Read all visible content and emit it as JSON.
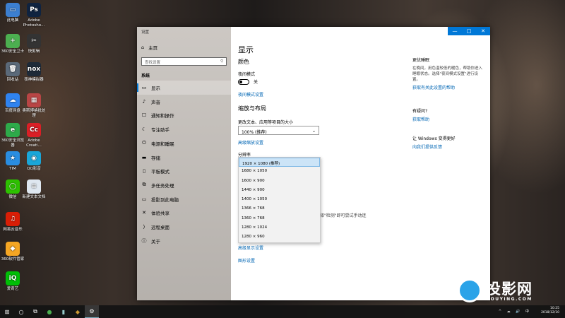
{
  "desktop": {
    "icons": [
      {
        "label": "此电脑",
        "glyph": "▭",
        "color": "#3c7fd0"
      },
      {
        "label": "Adobe Photosho...",
        "glyph": "Ps",
        "color": "#0f2340"
      },
      {
        "label": "360安全卫士",
        "glyph": "+",
        "color": "#4caf50"
      },
      {
        "label": "快剪辑",
        "glyph": "✂",
        "color": "#333333"
      },
      {
        "label": "回收站",
        "glyph": "🗑",
        "color": "#5b6a7a"
      },
      {
        "label": "夜神模拟器",
        "glyph": "nox",
        "color": "#1e2a38"
      },
      {
        "label": "百度网盘",
        "glyph": "☁",
        "color": "#2f83f0"
      },
      {
        "label": "奥斯博格批处理",
        "glyph": "▦",
        "color": "#b84545"
      },
      {
        "label": "360安全浏览器",
        "glyph": "e",
        "color": "#2eaa4a"
      },
      {
        "label": "Adobe Creati...",
        "glyph": "Cc",
        "color": "#da1f26"
      },
      {
        "label": "TIM",
        "glyph": "★",
        "color": "#2a8de0"
      },
      {
        "label": "QQ影音",
        "glyph": "◉",
        "color": "#1aa6d8"
      },
      {
        "label": "微信",
        "glyph": "◯",
        "color": "#2dc100"
      },
      {
        "label": "新建文本文档",
        "glyph": "≡",
        "color": "#dfe7f0"
      },
      {
        "label": "网易云音乐",
        "glyph": "♫",
        "color": "#d81e06"
      },
      {
        "label": "360软件管家",
        "glyph": "◆",
        "color": "#f5a623"
      },
      {
        "label": "爱奇艺",
        "glyph": "iQ",
        "color": "#00be06"
      }
    ]
  },
  "window": {
    "title": "设置",
    "controls": {
      "minimize": "—",
      "maximize": "□",
      "close": "✕"
    }
  },
  "sidebar": {
    "home_label": "主页",
    "search_placeholder": "查找设置",
    "section": "系统",
    "items": [
      {
        "label": "显示",
        "icon": "▭"
      },
      {
        "label": "声音",
        "icon": "♪"
      },
      {
        "label": "通知和操作",
        "icon": "☐"
      },
      {
        "label": "专注助手",
        "icon": "☾"
      },
      {
        "label": "电源和睡眠",
        "icon": "⏻"
      },
      {
        "label": "存储",
        "icon": "▬"
      },
      {
        "label": "平板模式",
        "icon": "▯"
      },
      {
        "label": "多任务处理",
        "icon": "⧉"
      },
      {
        "label": "投影到此电脑",
        "icon": "▭"
      },
      {
        "label": "体验共享",
        "icon": "✕"
      },
      {
        "label": "远程桌面",
        "icon": "⟩"
      },
      {
        "label": "关于",
        "icon": "ⓘ"
      }
    ]
  },
  "main": {
    "page_title": "显示",
    "color_heading": "颜色",
    "night_mode_label": "夜间模式",
    "night_mode_state": "关",
    "night_mode_link": "夜间模式设置",
    "scale_heading": "缩放与布局",
    "scale_label": "更改文本、应用等项目的大小",
    "scale_value": "100% (推荐)",
    "scale_link": "高级缩放设置",
    "resolution_label": "分辨率",
    "resolution_options": [
      "1920 × 1080 (推荐)",
      "1680 × 1050",
      "1600 × 900",
      "1440 × 900",
      "1400 × 1050",
      "1366 × 768",
      "1360 × 768",
      "1280 × 1024",
      "1280 × 960"
    ],
    "detect_hint": "选择\"检测\"即可尝试手动连",
    "advanced_display_link": "高级显示设置",
    "graphics_link": "图形设置"
  },
  "right_panel": {
    "sleep_heading": "更优睡眠",
    "sleep_text": "在晚间，用色温较低的暖色，帮助你进入睡眠状态。选择\"夜间模式设置\"进行设置。",
    "sleep_link": "获取有关此设置的帮助",
    "question_heading": "有疑问?",
    "question_link": "获取帮助",
    "better_heading": "让 Windows 变得更好",
    "better_link": "向我们提供反馈"
  },
  "taskbar": {
    "start_icon": "⊞",
    "search_icon": "○",
    "task_view_icon": "⧉",
    "settings_icon": "⚙",
    "tray_icons": "^ ☁ 🔊 中",
    "time": "10:25",
    "date": "2018/12/10"
  },
  "watermark": {
    "brand": "投影网",
    "url": "TOUYING.COM"
  }
}
